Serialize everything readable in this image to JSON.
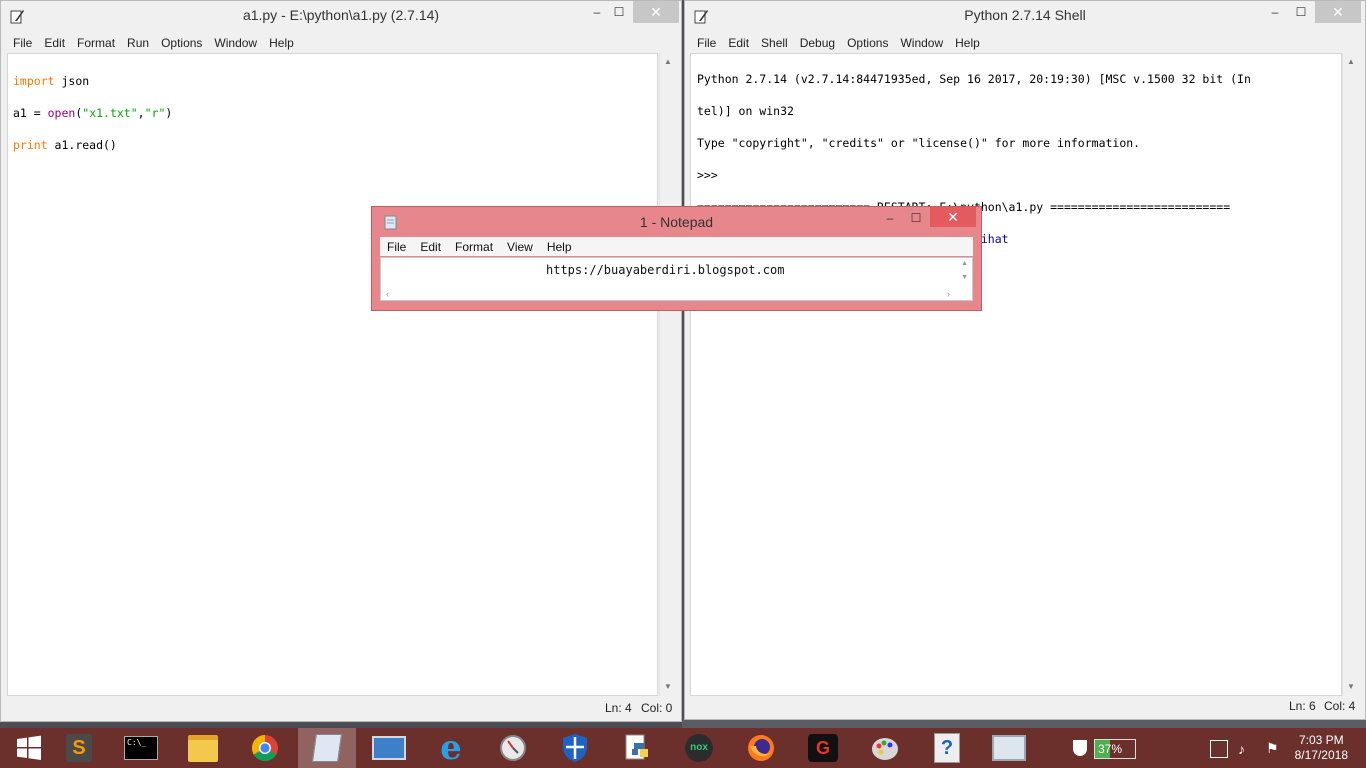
{
  "editor": {
    "title": "a1.py - E:\\python\\a1.py (2.7.14)",
    "menu": [
      "File",
      "Edit",
      "Format",
      "Run",
      "Options",
      "Window",
      "Help"
    ],
    "code": {
      "l1_kw": "import",
      "l1_rest": " json",
      "l2_a": "a1 = ",
      "l2_fn": "open",
      "l2_p1": "(",
      "l2_s1": "\"x1.txt\"",
      "l2_comma": ",",
      "l2_s2": "\"r\"",
      "l2_p2": ")",
      "l3_kw": "print",
      "l3_rest": " a1.read()"
    },
    "status_line": "Ln: 4",
    "status_col": "Col: 0"
  },
  "shell": {
    "title": "Python 2.7.14 Shell",
    "menu": [
      "File",
      "Edit",
      "Shell",
      "Debug",
      "Options",
      "Window",
      "Help"
    ],
    "lines": [
      "Python 2.7.14 (v2.7.14:84471935ed, Sep 16 2017, 20:19:30) [MSC v.1500 32 bit (In",
      "tel)] on win32",
      "Type \"copyright\", \"credits\" or \"license()\" for more information.",
      ">>> ",
      "========================= RESTART: E:\\python\\a1.py =========================="
    ],
    "output": "Haiii ini aku,aku ini seperti yang kamu lihat",
    "prompt": ">>> ",
    "status_line": "Ln: 6",
    "status_col": "Col: 4"
  },
  "notepad": {
    "title": "1 - Notepad",
    "menu": [
      "File",
      "Edit",
      "Format",
      "View",
      "Help"
    ],
    "content": "https://buayaberdiri.blogspot.com"
  },
  "window_controls": {
    "minimize": "–",
    "maximize": "☐",
    "close": "✕"
  },
  "taskbar": {
    "items": [
      "windows-start-icon",
      "sublime-text-icon",
      "cmd-icon",
      "file-explorer-icon",
      "chrome-icon",
      "notepad-icon",
      "remote-desktop-icon",
      "internet-explorer-icon",
      "clock-utility-icon",
      "defender-icon",
      "python-idle-icon",
      "nox-icon",
      "firefox-icon",
      "garena-icon",
      "paint-icon",
      "help-icon",
      "system-monitor-icon"
    ],
    "battery": "37%",
    "time": "7:03 PM",
    "date": "8/17/2018",
    "accent": "#6b2f2c"
  },
  "colors": {
    "keyword": "#ff7700",
    "builtin": "#900090",
    "string": "#00aa00",
    "output": "#0000c0",
    "notepad_title": "#e7878c"
  }
}
